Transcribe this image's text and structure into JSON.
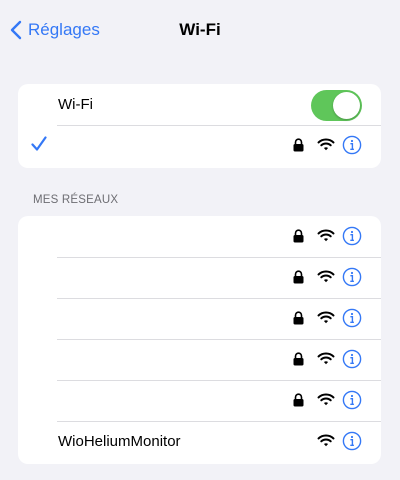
{
  "navbar": {
    "back_label": "Réglages",
    "title": "Wi-Fi"
  },
  "wifi_toggle": {
    "label": "Wi-Fi",
    "on": true
  },
  "connected_network": {
    "name": "",
    "secured": true
  },
  "my_networks": {
    "header": "MES RÉSEAUX",
    "items": [
      {
        "name": "",
        "secured": true
      },
      {
        "name": "",
        "secured": true
      },
      {
        "name": "",
        "secured": true
      },
      {
        "name": "",
        "secured": true
      },
      {
        "name": "",
        "secured": true
      },
      {
        "name": "WioHeliumMonitor",
        "secured": false
      }
    ]
  },
  "colors": {
    "accent": "#3478f6",
    "toggle_on": "#5fc65a",
    "background": "#f2f2f7"
  },
  "icons": [
    "chevron-left-icon",
    "checkmark-icon",
    "lock-icon",
    "wifi-icon",
    "info-icon"
  ]
}
